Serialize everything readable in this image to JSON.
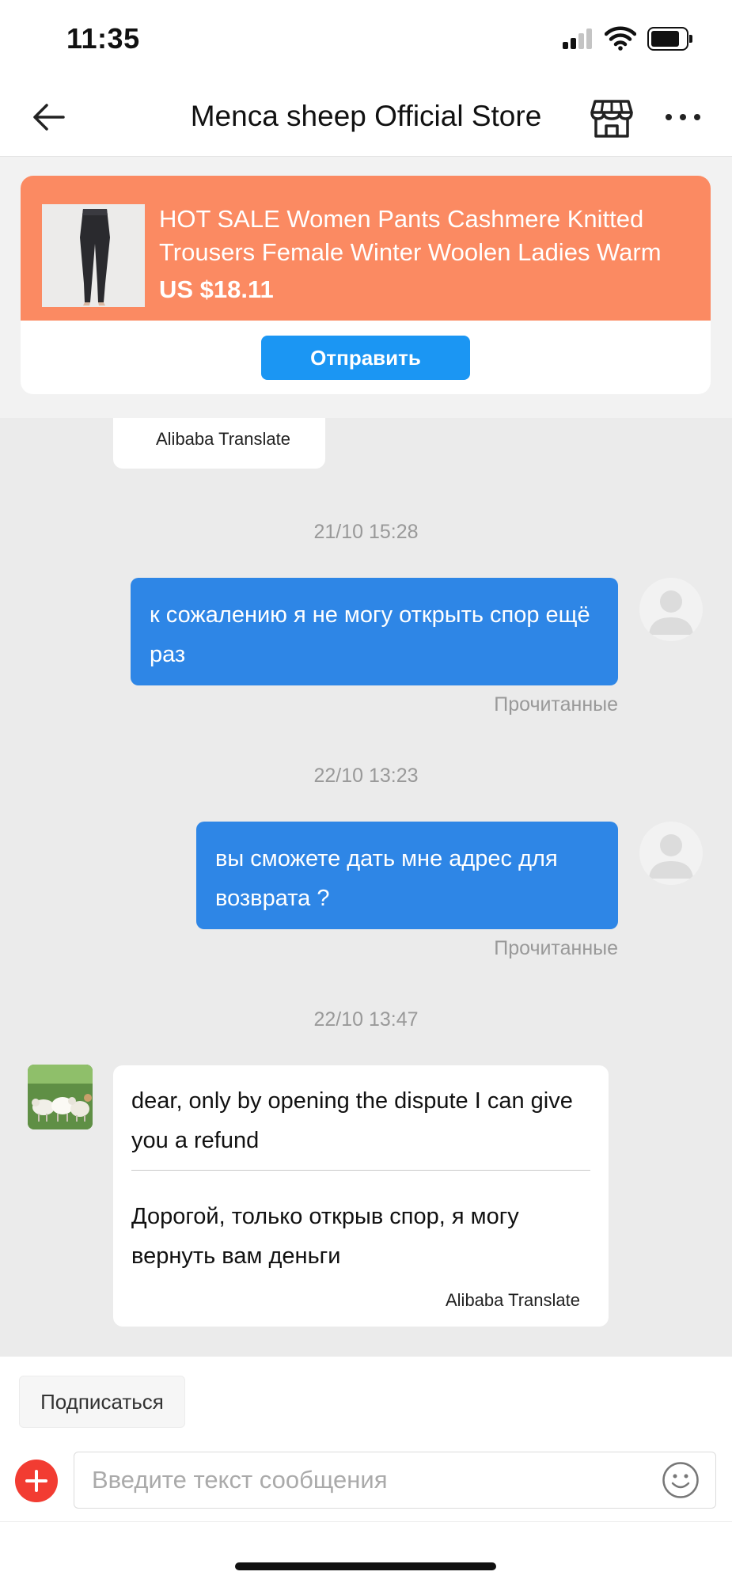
{
  "status_bar": {
    "time": "11:35",
    "icons": [
      "cellular-signal-icon",
      "wifi-icon",
      "battery-icon"
    ]
  },
  "header": {
    "title": "Menca sheep Official Store",
    "icons": [
      "back-arrow-icon",
      "store-icon",
      "more-icon"
    ]
  },
  "product": {
    "title": "HOT SALE Women Pants Cashmere Knitted Trousers Female Winter Woolen Ladies Warm",
    "price": "US $18.11",
    "send_label": "Отправить",
    "card_color": "#fb8a62",
    "button_color": "#1b96f3"
  },
  "chat": {
    "messages": [
      {
        "type": "translation-credit",
        "credit": "Alibaba Translate"
      },
      {
        "type": "outgoing",
        "timestamp": "21/10 15:28",
        "text": "к сожалению я не могу открыть спор ещё раз",
        "status": "Прочитанные"
      },
      {
        "type": "outgoing",
        "timestamp": "22/10 13:23",
        "text": "вы сможете дать мне адрес для возврата ?",
        "status": "Прочитанные"
      },
      {
        "type": "incoming",
        "timestamp": "22/10 13:47",
        "text": "dear, only by opening the dispute  I can give you a refund",
        "translation": "Дорогой, только открыв спор, я могу вернуть вам деньги",
        "credit": "Alibaba Translate"
      }
    ],
    "outgoing_color": "#2e86e6"
  },
  "composer": {
    "subscribe_label": "Подписаться",
    "input_placeholder": "Введите текст сообщения",
    "input_value": "",
    "icons": [
      "add-icon",
      "emoji-icon"
    ],
    "add_color": "#f23c32"
  }
}
